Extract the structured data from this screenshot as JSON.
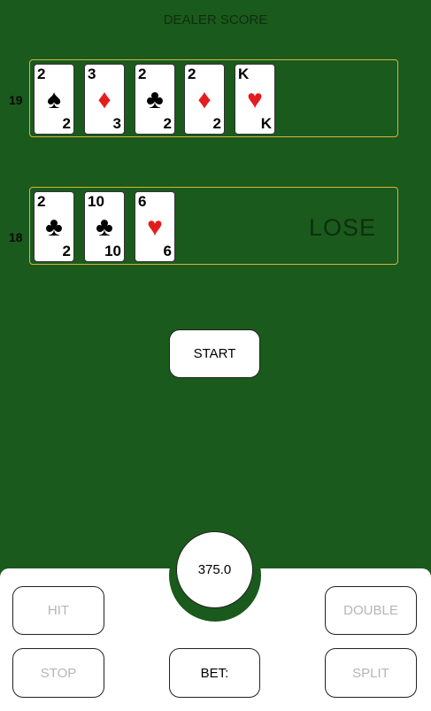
{
  "header": {
    "title": "DEALER SCORE"
  },
  "dealer": {
    "score": "19",
    "cards": [
      {
        "rank": "2",
        "suit": "♠",
        "color": "black"
      },
      {
        "rank": "3",
        "suit": "♦",
        "color": "red"
      },
      {
        "rank": "2",
        "suit": "♣",
        "color": "black"
      },
      {
        "rank": "2",
        "suit": "♦",
        "color": "red"
      },
      {
        "rank": "K",
        "suit": "♥",
        "color": "red"
      }
    ]
  },
  "player": {
    "score": "18",
    "result": "LOSE",
    "cards": [
      {
        "rank": "2",
        "suit": "♣",
        "color": "black"
      },
      {
        "rank": "10",
        "suit": "♣",
        "color": "black"
      },
      {
        "rank": "6",
        "suit": "♥",
        "color": "red"
      }
    ]
  },
  "controls": {
    "start_label": "START",
    "balance": "375.0",
    "hit_label": "HIT",
    "double_label": "DOUBLE",
    "stop_label": "STOP",
    "bet_label": "BET:",
    "split_label": "SPLIT"
  },
  "colors": {
    "table": "#1a5a1c",
    "hand_border": "#d7b43a",
    "red_suit": "#e31d1d",
    "disabled_text": "#b5b5b5"
  }
}
